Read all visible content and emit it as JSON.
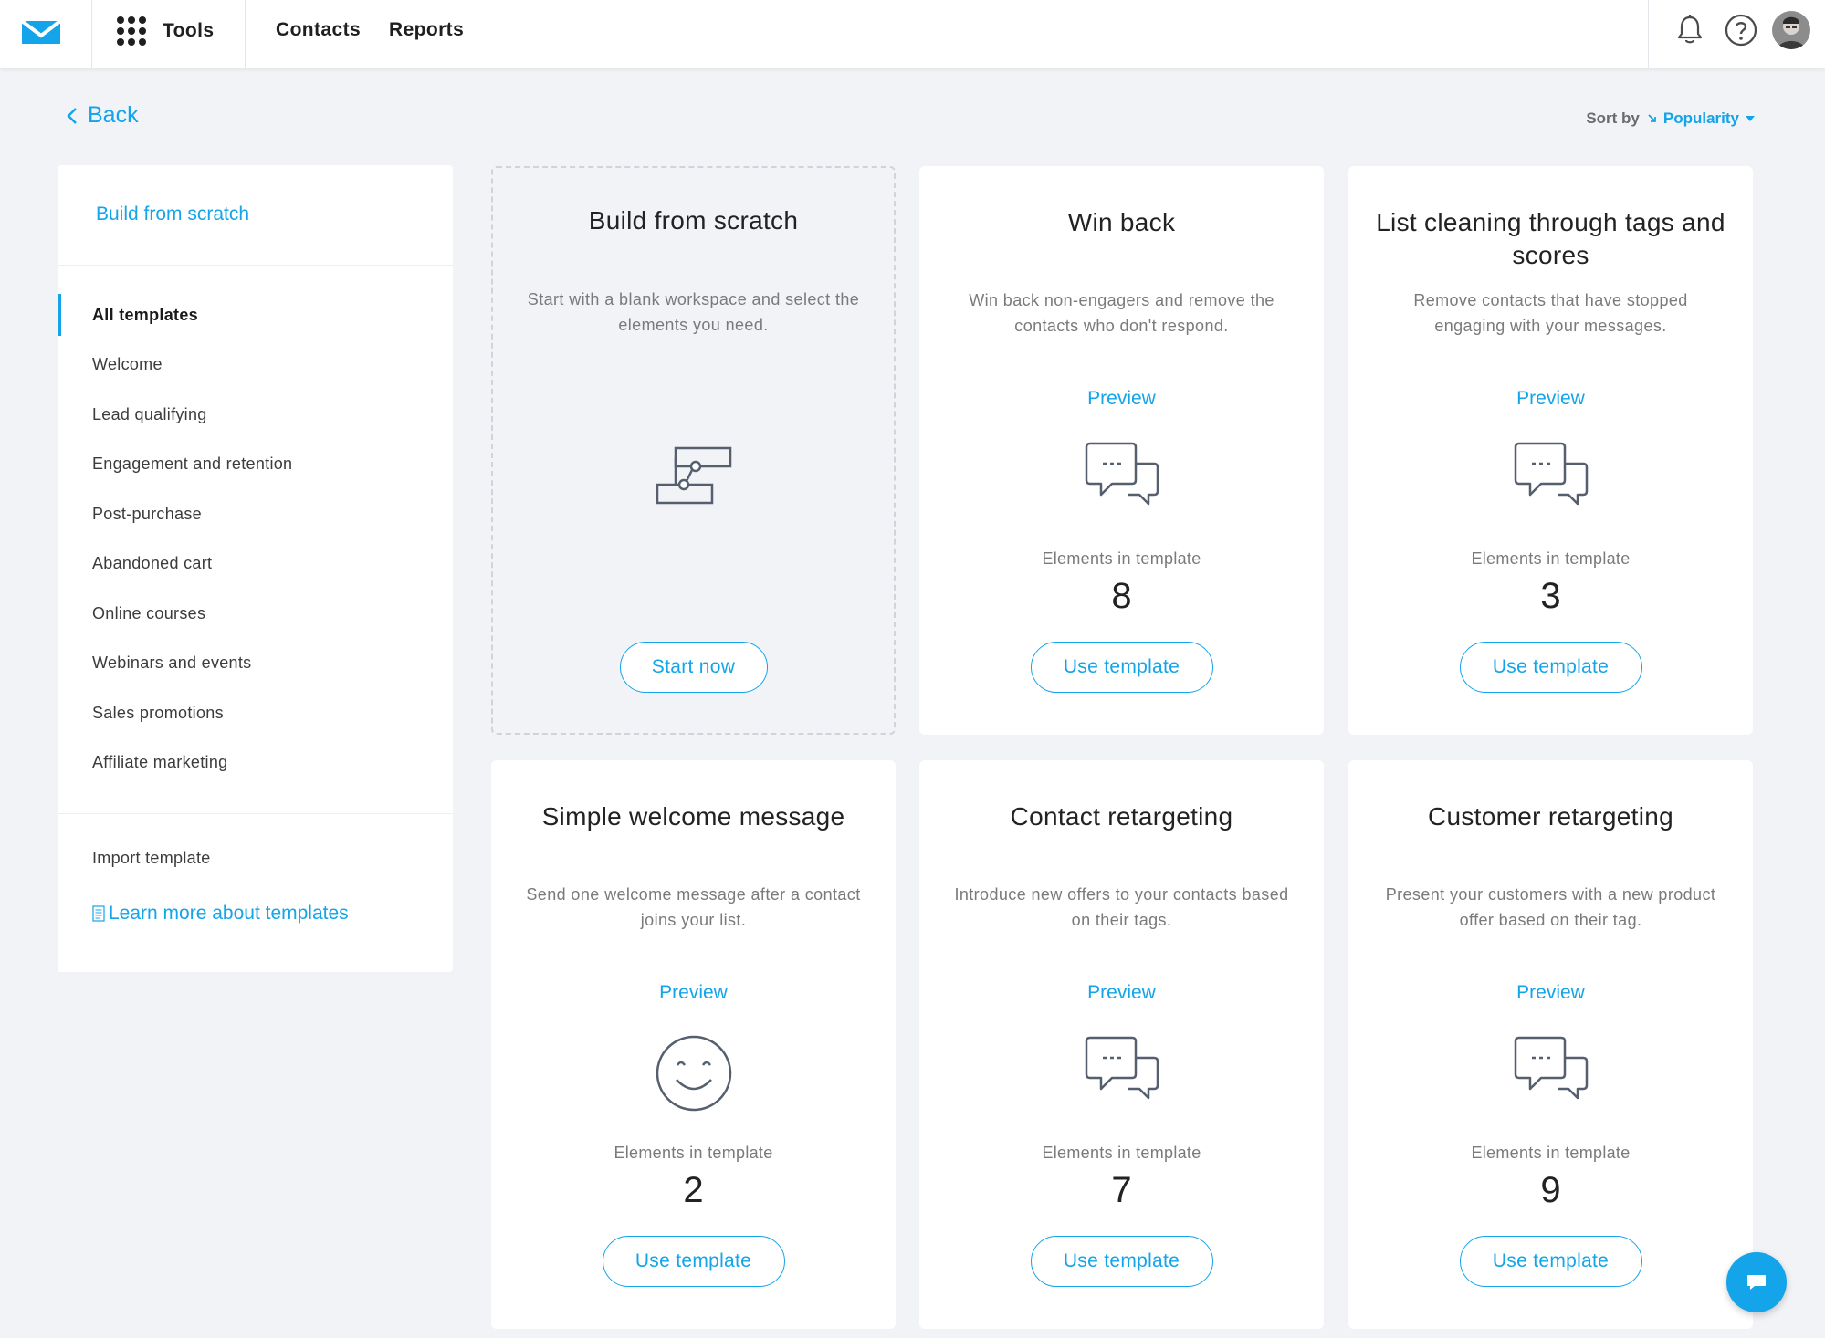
{
  "colors": {
    "accent": "#13a4e9",
    "background": "#f1f3f6",
    "card": "#ffffff"
  },
  "topbar": {
    "tools_label": "Tools",
    "nav": [
      "Contacts",
      "Reports"
    ],
    "icons": [
      "mail-logo-icon",
      "apps-grid-icon",
      "bell-icon",
      "help-icon",
      "avatar"
    ]
  },
  "back_label": "Back",
  "sort": {
    "label": "Sort by",
    "value": "Popularity"
  },
  "sidebar": {
    "build_link": "Build from scratch",
    "categories": [
      "All templates",
      "Welcome",
      "Lead qualifying",
      "Engagement and retention",
      "Post-purchase",
      "Abandoned cart",
      "Online courses",
      "Webinars and events",
      "Sales promotions",
      "Affiliate marketing"
    ],
    "active_category": "All templates",
    "import_label": "Import template",
    "learn_label": "Learn more about templates"
  },
  "cards": [
    {
      "title": "Build from scratch",
      "description": "Start with a blank workspace and select the elements you need.",
      "icon": "workflow-icon",
      "button": "Start now"
    },
    {
      "title": "Win back",
      "description": "Win back non-engagers and remove the contacts who don't respond.",
      "preview": "Preview",
      "icon": "chat-bubbles-icon",
      "elements_label": "Elements in template",
      "elements_count": "8",
      "button": "Use template"
    },
    {
      "title": "List cleaning through tags and scores",
      "description": "Remove contacts that have stopped engaging with your messages.",
      "preview": "Preview",
      "icon": "chat-bubbles-icon",
      "elements_label": "Elements in template",
      "elements_count": "3",
      "button": "Use template"
    },
    {
      "title": "Simple welcome message",
      "description": "Send one welcome message after a contact joins your list.",
      "preview": "Preview",
      "icon": "smiley-icon",
      "elements_label": "Elements in template",
      "elements_count": "2",
      "button": "Use template"
    },
    {
      "title": "Contact retargeting",
      "description": "Introduce new offers to your contacts based on their tags.",
      "preview": "Preview",
      "icon": "chat-bubbles-icon",
      "elements_label": "Elements in template",
      "elements_count": "7",
      "button": "Use template"
    },
    {
      "title": "Customer retargeting",
      "description": "Present your customers with a new product offer based on their tag.",
      "preview": "Preview",
      "icon": "chat-bubbles-icon",
      "elements_label": "Elements in template",
      "elements_count": "9",
      "button": "Use template"
    }
  ]
}
